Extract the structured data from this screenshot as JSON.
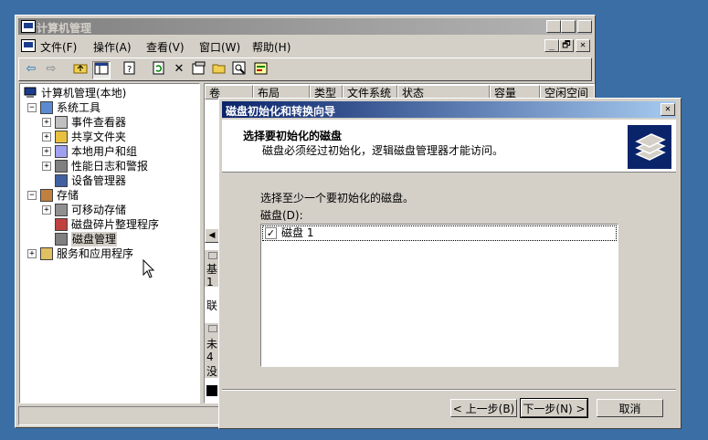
{
  "mmc": {
    "title": "计算机管理",
    "menu": [
      "文件(F)",
      "操作(A)",
      "查看(V)",
      "窗口(W)",
      "帮助(H)"
    ],
    "title_buttons": [
      "_",
      "□",
      "✕"
    ],
    "menu_buttons": [
      "_",
      "🗗",
      "✕"
    ],
    "toolbar_icons": [
      "back-arrow-icon",
      "forward-arrow-icon",
      "up-folder-icon",
      "show-tree-icon",
      "properties-icon",
      "refresh-icon",
      "delete-icon",
      "properties-sheet-icon",
      "open-folder-icon",
      "search-icon",
      "help-icon"
    ],
    "tree": {
      "root": "计算机管理(本地)",
      "items": [
        {
          "label": "系统工具",
          "level": 1,
          "expander": "−"
        },
        {
          "label": "事件查看器",
          "level": 2,
          "expander": "+"
        },
        {
          "label": "共享文件夹",
          "level": 2,
          "expander": "+"
        },
        {
          "label": "本地用户和组",
          "level": 2,
          "expander": "+"
        },
        {
          "label": "性能日志和警报",
          "level": 2,
          "expander": "+"
        },
        {
          "label": "设备管理器",
          "level": 2,
          "expander": ""
        },
        {
          "label": "存储",
          "level": 1,
          "expander": "−"
        },
        {
          "label": "可移动存储",
          "level": 2,
          "expander": "+"
        },
        {
          "label": "磁盘碎片整理程序",
          "level": 2,
          "expander": ""
        },
        {
          "label": "磁盘管理",
          "level": 2,
          "expander": ""
        },
        {
          "label": "服务和应用程序",
          "level": 1,
          "expander": "+"
        }
      ]
    },
    "columns": [
      "卷",
      "布局",
      "类型",
      "文件系统",
      "状态",
      "容量",
      "空闲空间"
    ],
    "list_fragments": [
      "基",
      "1",
      "联",
      "未",
      "4",
      "没"
    ]
  },
  "dialog": {
    "title": "磁盘初始化和转换向导",
    "heading": "选择要初始化的磁盘",
    "subheading": "磁盘必须经过初始化，逻辑磁盘管理器才能访问。",
    "instruction": "选择至少一个要初始化的磁盘。",
    "list_label": "磁盘(D):",
    "disks": [
      {
        "label": "磁盘 1",
        "checked": true
      }
    ],
    "buttons": {
      "back": "< 上一步(B)",
      "next": "下一步(N) >",
      "cancel": "取消"
    }
  }
}
